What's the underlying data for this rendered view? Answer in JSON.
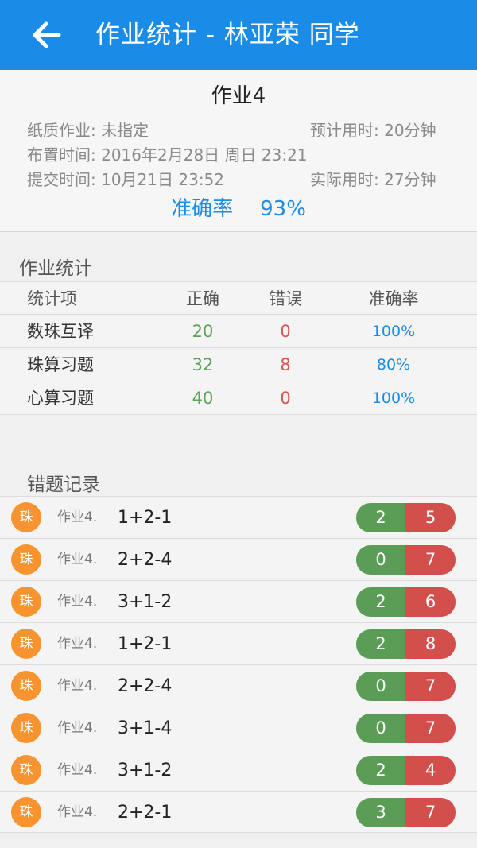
{
  "header": {
    "title": "作业统计 - 林亚荣 同学",
    "back_icon": "arrow-left-icon",
    "color": "#1a8ce8"
  },
  "summary": {
    "name": "作业4",
    "paper_label": "纸质作业:",
    "paper_value": "未指定",
    "estimated_label": "预计用时:",
    "estimated_value": "20分钟",
    "assign_label": "布置时间:",
    "assign_value": "2016年2月28日 周日 23:21",
    "submit_label": "提交时间:",
    "submit_value": "10月21日 23:52",
    "actual_label": "实际用时:",
    "actual_value": "27分钟",
    "accuracy_label": "准确率",
    "accuracy_value": "93%"
  },
  "stats": {
    "title": "作业统计",
    "columns": [
      "统计项",
      "正确",
      "错误",
      "准确率"
    ],
    "rows": [
      {
        "name": "数珠互译",
        "correct": "20",
        "wrong": "0",
        "rate": "100%"
      },
      {
        "name": "珠算习题",
        "correct": "32",
        "wrong": "8",
        "rate": "80%"
      },
      {
        "name": "心算习题",
        "correct": "40",
        "wrong": "0",
        "rate": "100%"
      }
    ]
  },
  "mistakes": {
    "title": "错题记录",
    "colors": {
      "badge": "#f7942f",
      "right": "#5a9d57",
      "wrong": "#d24f4c"
    },
    "items": [
      {
        "badge": "珠",
        "tag": "作业4.",
        "expr": "1+2-1",
        "right": "2",
        "wrong": "5"
      },
      {
        "badge": "珠",
        "tag": "作业4.",
        "expr": "2+2-4",
        "right": "0",
        "wrong": "7"
      },
      {
        "badge": "珠",
        "tag": "作业4.",
        "expr": "3+1-2",
        "right": "2",
        "wrong": "6"
      },
      {
        "badge": "珠",
        "tag": "作业4.",
        "expr": "1+2-1",
        "right": "2",
        "wrong": "8"
      },
      {
        "badge": "珠",
        "tag": "作业4.",
        "expr": "2+2-4",
        "right": "0",
        "wrong": "7"
      },
      {
        "badge": "珠",
        "tag": "作业4.",
        "expr": "3+1-4",
        "right": "0",
        "wrong": "7"
      },
      {
        "badge": "珠",
        "tag": "作业4.",
        "expr": "3+1-2",
        "right": "2",
        "wrong": "4"
      },
      {
        "badge": "珠",
        "tag": "作业4.",
        "expr": "2+2-1",
        "right": "3",
        "wrong": "7"
      }
    ]
  }
}
